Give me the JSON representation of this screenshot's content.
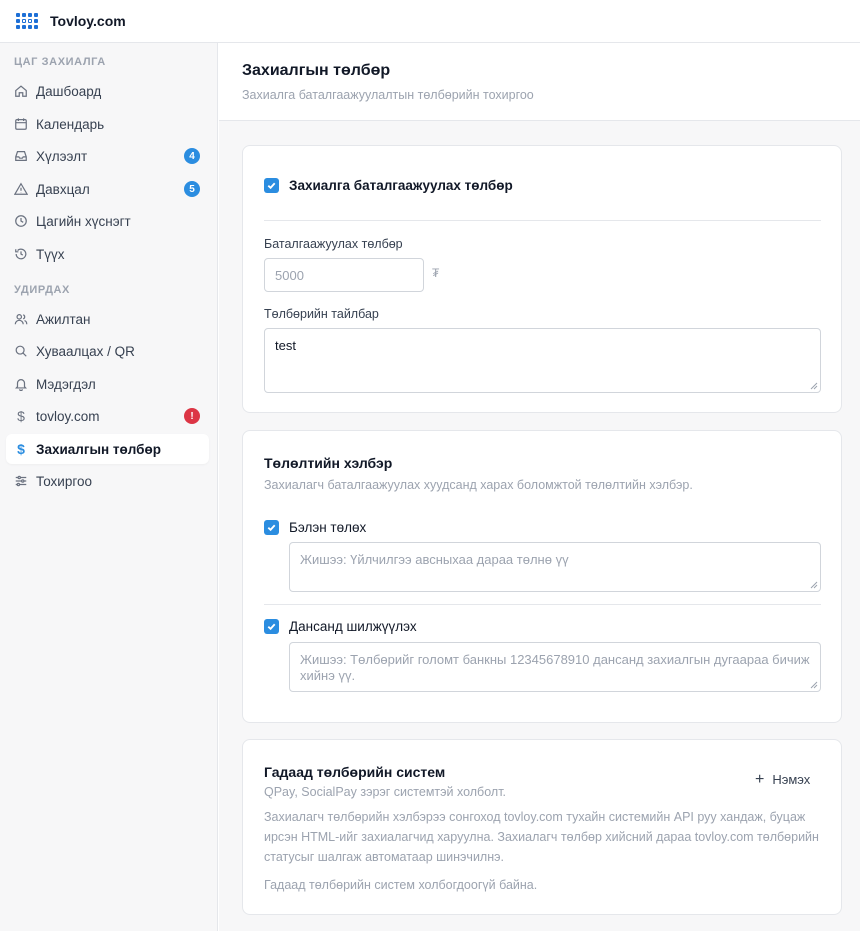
{
  "app": {
    "brand": "Tovloy.com"
  },
  "sidebar": {
    "section1": "ЦАГ ЗАХИАЛГА",
    "section2": "УДИРДАХ",
    "items": [
      {
        "label": "Дашбоард",
        "icon": "home-icon"
      },
      {
        "label": "Календарь",
        "icon": "calendar-icon"
      },
      {
        "label": "Хүлээлт",
        "icon": "inbox-icon",
        "badge": "4"
      },
      {
        "label": "Давхцал",
        "icon": "warning-icon",
        "badge": "5"
      },
      {
        "label": "Цагийн хүснэгт",
        "icon": "clock-icon"
      },
      {
        "label": "Түүх",
        "icon": "history-icon"
      },
      {
        "label": "Ажилтан",
        "icon": "users-icon"
      },
      {
        "label": "Хуваалцах / QR",
        "icon": "search-icon"
      },
      {
        "label": "Мэдэгдэл",
        "icon": "bell-icon"
      },
      {
        "label": "tovloy.com",
        "icon": "dollar-icon",
        "badge": "!"
      },
      {
        "label": "Захиалгын төлбөр",
        "icon": "dollar-icon"
      },
      {
        "label": "Тохиргоо",
        "icon": "sliders-icon"
      }
    ]
  },
  "header": {
    "title": "Захиалгын төлбөр",
    "subtitle": "Захиалга баталгаажуулалтын төлбөрийн тохиргоо"
  },
  "card1": {
    "checkbox_label": "Захиалга баталгаажуулах төлбөр",
    "fee_label": "Баталгаажуулах төлбөр",
    "fee_placeholder": "5000",
    "currency": "₮",
    "desc_label": "Төлбөрийн тайлбар",
    "desc_value": "test"
  },
  "card2": {
    "title": "Төлөлтийн хэлбэр",
    "description": "Захиалагч баталгаажуулах хуудсанд харах боломжтой төлөлтийн хэлбэр.",
    "option1_label": "Бэлэн төлөх",
    "option1_placeholder": "Жишээ: Үйлчилгээ авсныхаа дараа төлнө үү",
    "option2_label": "Дансанд шилжүүлэх",
    "option2_placeholder": "Жишээ: Төлбөрийг голомт банкны 12345678910 дансанд захиалгын дугаараа бичиж хийнэ үү."
  },
  "card3": {
    "title": "Гадаад төлбөрийн систем",
    "subtitle": "QPay, SocialPay зэрэг системтэй холболт.",
    "add_label": "Нэмэх",
    "description": "Захиалагч төлбөрийн хэлбэрээ сонгоход tovloy.com тухайн системийн API руу хандаж, буцаж ирсэн HTML-ийг захиалагчид харуулна. Захиалагч төлбөр хийсний дараа tovloy.com төлбөрийн статусыг шалгаж автоматаар шинэчилнэ.",
    "empty_text": "Гадаад төлбөрийн систем холбогдоогүй байна."
  },
  "colors": {
    "accent": "#2b8de0",
    "danger": "#dc3545"
  }
}
